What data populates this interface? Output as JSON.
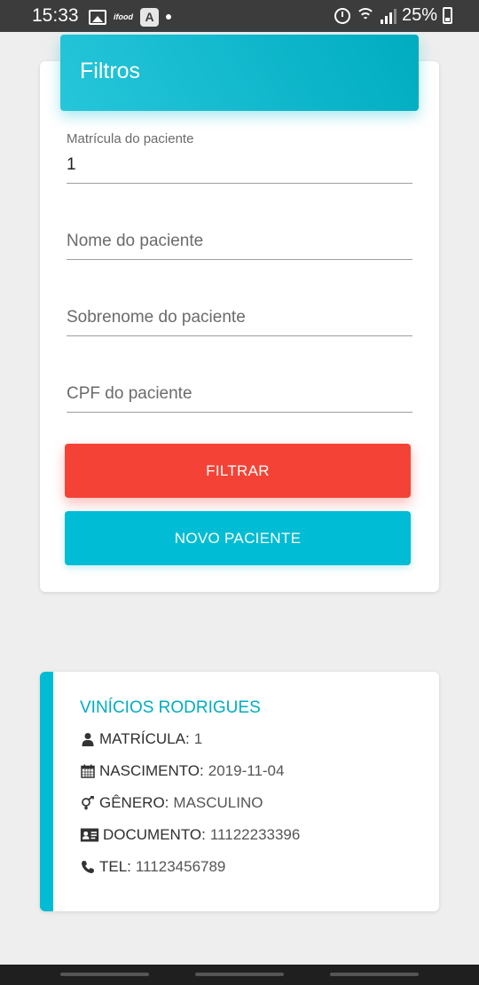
{
  "status_bar": {
    "time": "15:33",
    "app_icon_text": "ifood",
    "battery": "25%"
  },
  "filter": {
    "title": "Filtros",
    "registration": {
      "label": "Matrícula do paciente",
      "value": "1"
    },
    "first_name": {
      "placeholder": "Nome do paciente"
    },
    "last_name": {
      "placeholder": "Sobrenome do paciente"
    },
    "cpf": {
      "placeholder": "CPF do paciente"
    },
    "filter_button": "FILTRAR",
    "new_button": "NOVO PACIENTE"
  },
  "patient": {
    "name": "VINÍCIOS RODRIGUES",
    "registration_label": "MATRÍCULA:",
    "registration": "1",
    "birth_label": "NASCIMENTO:",
    "birth": "2019-11-04",
    "gender_label": "GÊNERO:",
    "gender": "MASCULINO",
    "document_label": "DOCUMENTO:",
    "document": "11122233396",
    "phone_label": "TEL:",
    "phone": "11123456789"
  },
  "colors": {
    "accent": "#00bcd4",
    "danger": "#f44336",
    "background": "#eeeeee"
  }
}
